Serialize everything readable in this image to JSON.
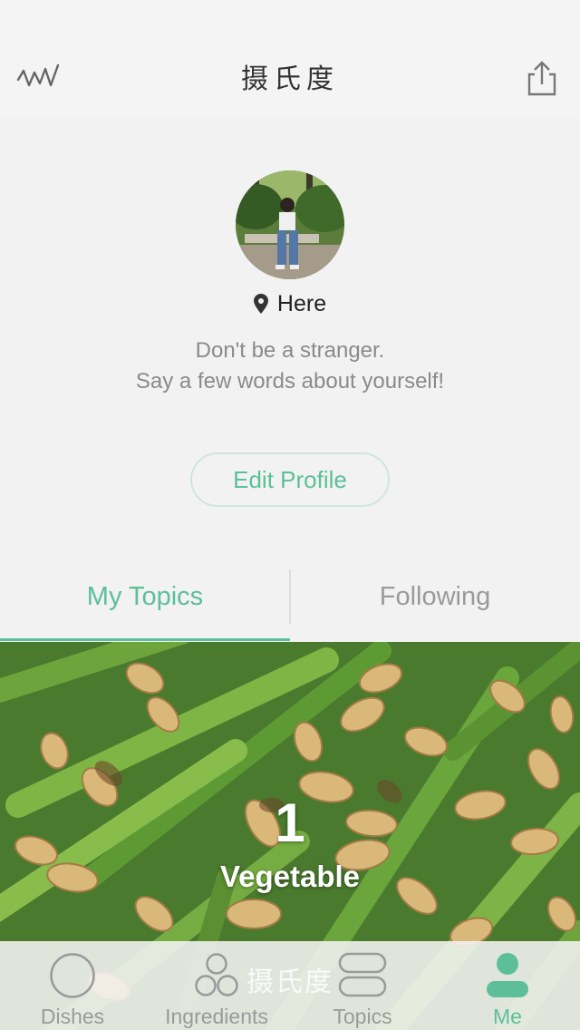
{
  "nav": {
    "title": "摄氏度",
    "left_icon": "activity-wave-icon",
    "right_icon": "share-icon"
  },
  "profile": {
    "location": "Here",
    "bio_line1": "Don't be a stranger.",
    "bio_line2": "Say a few words about yourself!",
    "edit_button": "Edit Profile"
  },
  "tabs": [
    {
      "label": "My Topics",
      "active": true
    },
    {
      "label": "Following",
      "active": false
    }
  ],
  "topic": {
    "count": "1",
    "label": "Vegetable"
  },
  "tabbar": {
    "watermark": "摄氏度",
    "items": [
      {
        "label": "Dishes",
        "icon": "circle-icon"
      },
      {
        "label": "Ingredients",
        "icon": "three-circles-icon"
      },
      {
        "label": "Topics",
        "icon": "stacked-pills-icon"
      },
      {
        "label": "Me",
        "icon": "person-icon",
        "active": true
      }
    ]
  },
  "colors": {
    "accent": "#5cbf9a",
    "background": "#f2f2f2",
    "muted": "#9a9a9a"
  }
}
